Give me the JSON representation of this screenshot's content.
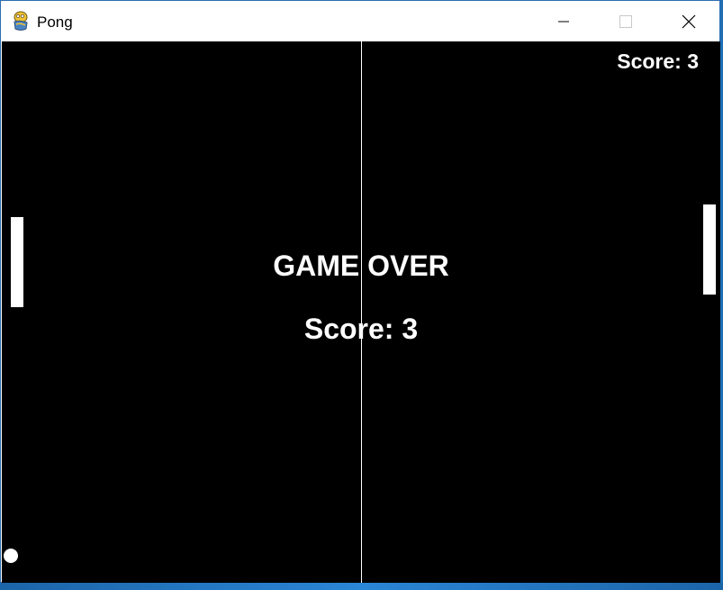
{
  "window": {
    "title": "Pong",
    "app_icon": "python-snake-icon",
    "controls": {
      "minimize_icon": "minimize-icon",
      "maximize_icon": "maximize-icon",
      "close_icon": "close-icon"
    }
  },
  "game": {
    "score_label": "Score: 3",
    "game_over_text": "GAME OVER",
    "final_score_text": "Score: 3",
    "colors": {
      "background": "#000000",
      "foreground": "#ffffff"
    }
  }
}
